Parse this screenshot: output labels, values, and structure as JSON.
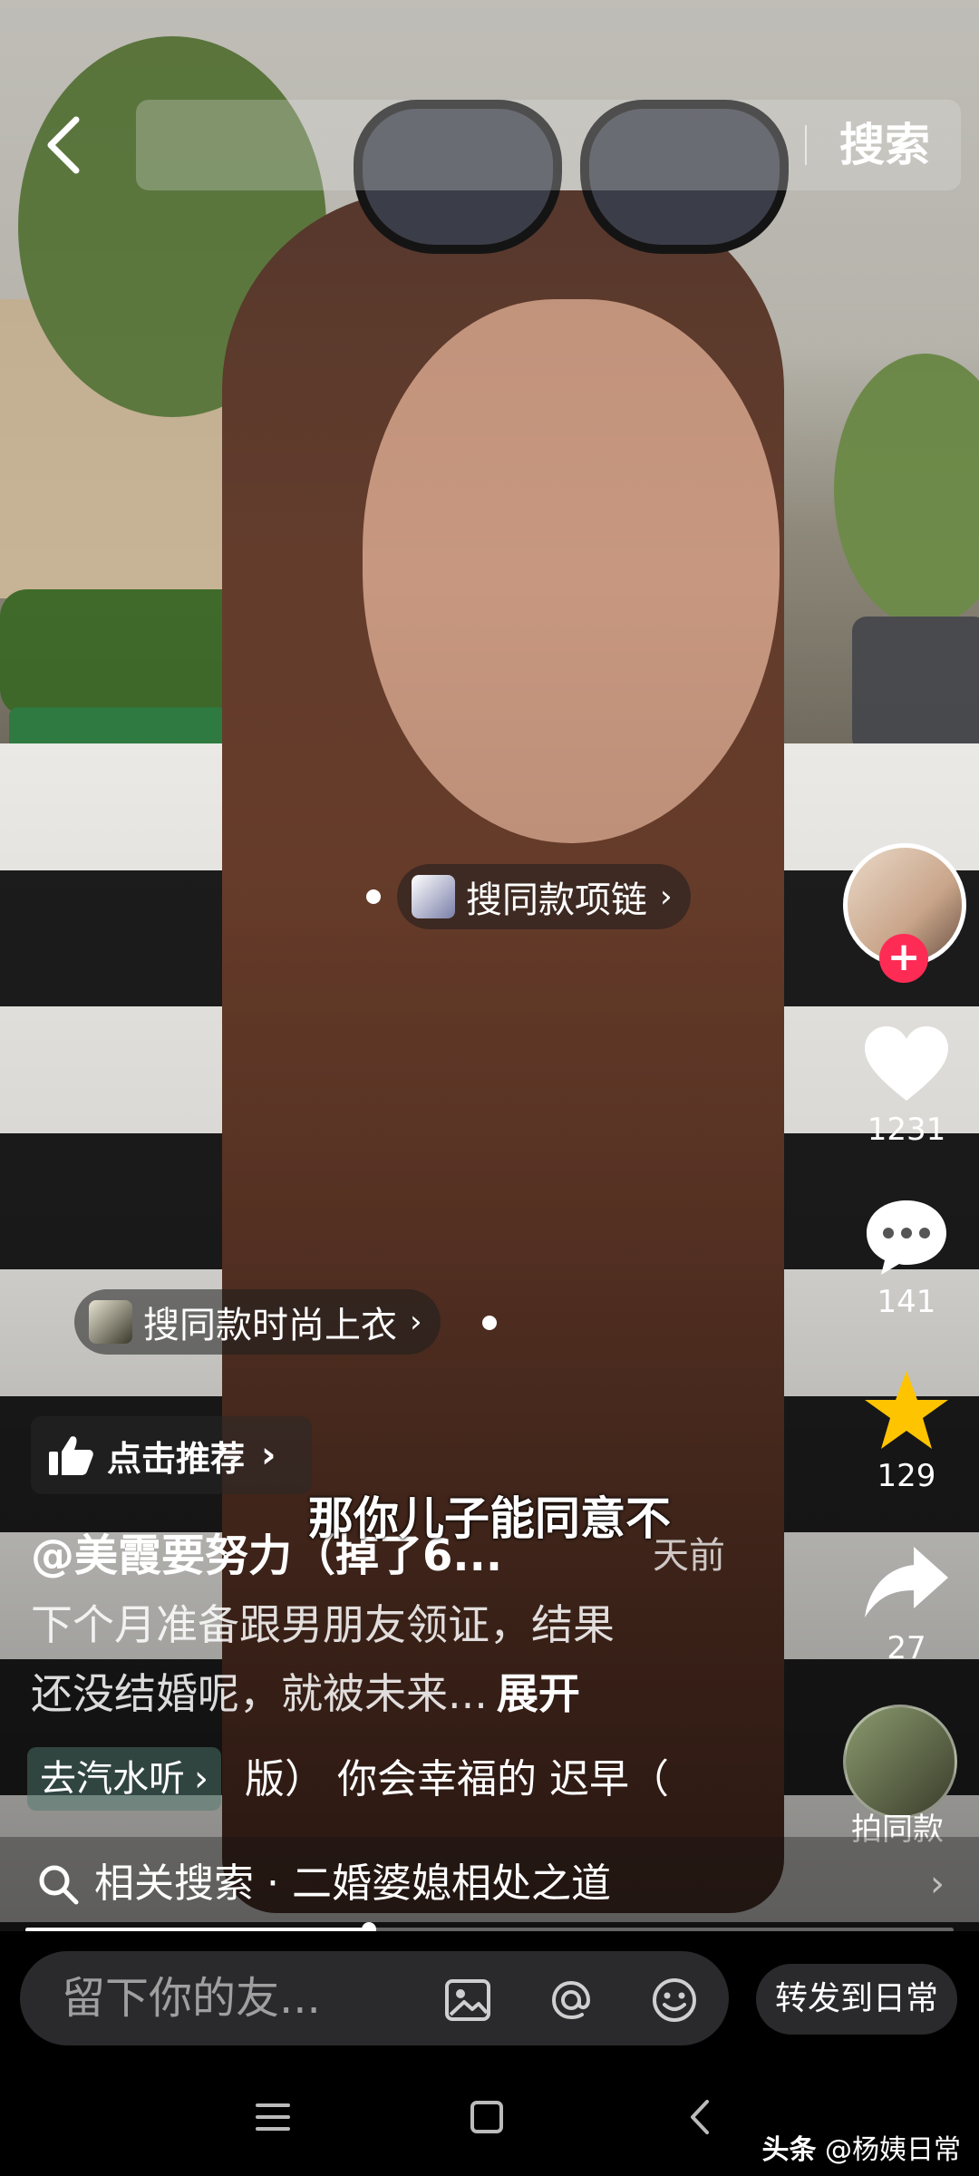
{
  "search": {
    "button_label": "搜索"
  },
  "tags": {
    "necklace": "搜同款项链",
    "top": "搜同款时尚上衣"
  },
  "rail": {
    "likes": "1231",
    "comments": "141",
    "favorites": "129",
    "shares": "27",
    "shoot_same_label": "拍同款"
  },
  "video": {
    "recommend_label": "点击推荐",
    "subtitle": "那你儿子能同意不",
    "author": "@美霞要努力（掉了6...",
    "time": "天前",
    "desc_line1": "下个月准备跟男朋友领证，结果",
    "desc_line2": "还没结婚呢，就被未来...",
    "expand": "展开",
    "music_pill": "去汽水听",
    "music_text": "版）   你会幸福的 迟早（",
    "progress": 0.37
  },
  "related": {
    "label": "相关搜索 · 二婚婆媳相处之道"
  },
  "comment": {
    "placeholder": "留下你的友...",
    "forward_label": "转发到日常"
  },
  "watermark": {
    "prefix": "头条",
    "handle": "@杨姨日常"
  },
  "colors": {
    "follow": "#fe2c55",
    "favorite": "#ffc400"
  },
  "icons": [
    "back-icon",
    "heart-icon",
    "comment-icon",
    "star-icon",
    "share-icon",
    "thumbs-up-icon",
    "search-icon",
    "image-icon",
    "at-icon",
    "emoji-icon",
    "menu-icon",
    "home-icon",
    "back-nav-icon"
  ]
}
